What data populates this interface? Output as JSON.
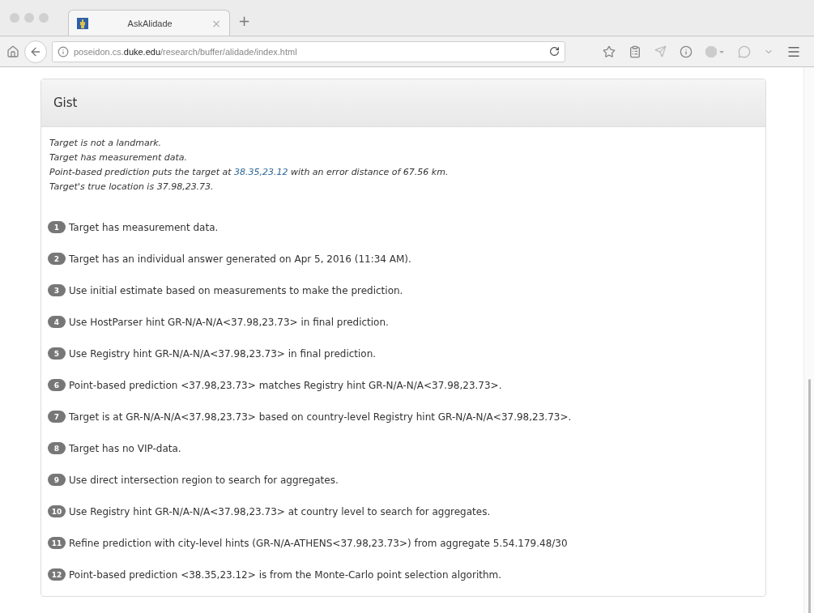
{
  "tab": {
    "title": "AskAlidade",
    "close": "×",
    "new_tab": "+"
  },
  "address_bar": {
    "url": "poseidon.cs.**duke.edu**/research/buffer/alidade/index.html"
  },
  "panel": {
    "title": "Gist",
    "summary": [
      {
        "kind": "plain",
        "text": "Target is not a landmark."
      },
      {
        "kind": "plain",
        "text": "Target has measurement data."
      },
      {
        "kind": "link",
        "before": "Point-based prediction puts the target at",
        "link": "38.35,23.12",
        "after": "with an error distance of 67.56 km."
      },
      {
        "kind": "plain",
        "text": "Target's true location is 37.98,23.73."
      }
    ],
    "steps": [
      {
        "number": "1",
        "text": "Target has measurement data."
      },
      {
        "number": "2",
        "text": "Target has an individual answer generated on Apr 5, 2016 (11:34 AM)."
      },
      {
        "number": "3",
        "text": "Use initial estimate based on measurements to make the prediction."
      },
      {
        "number": "4",
        "text": "Use HostParser hint GR-N/A-N/A<37.98,23.73> in final prediction."
      },
      {
        "number": "5",
        "text": "Use Registry hint GR-N/A-N/A<37.98,23.73> in final prediction."
      },
      {
        "number": "6",
        "text": "Point-based prediction <37.98,23.73> matches Registry hint GR-N/A-N/A<37.98,23.73>."
      },
      {
        "number": "7",
        "text": "Target is at GR-N/A-N/A<37.98,23.73> based on country-level Registry hint GR-N/A-N/A<37.98,23.73>."
      },
      {
        "number": "8",
        "text": "Target has no VIP-data."
      },
      {
        "number": "9",
        "text": "Use direct intersection region to search for aggregates."
      },
      {
        "number": "10",
        "text": "Use Registry hint GR-N/A-N/A<37.98,23.73> at country level to search for aggregates."
      },
      {
        "number": "11",
        "text": "Refine prediction with city-level hints (GR-N/A-ATHENS<37.98,23.73>) from aggregate 5.54.179.48/30"
      },
      {
        "number": "12",
        "text": "Point-based prediction <38.35,23.12> is from the Monte-Carlo point selection algorithm."
      }
    ]
  }
}
